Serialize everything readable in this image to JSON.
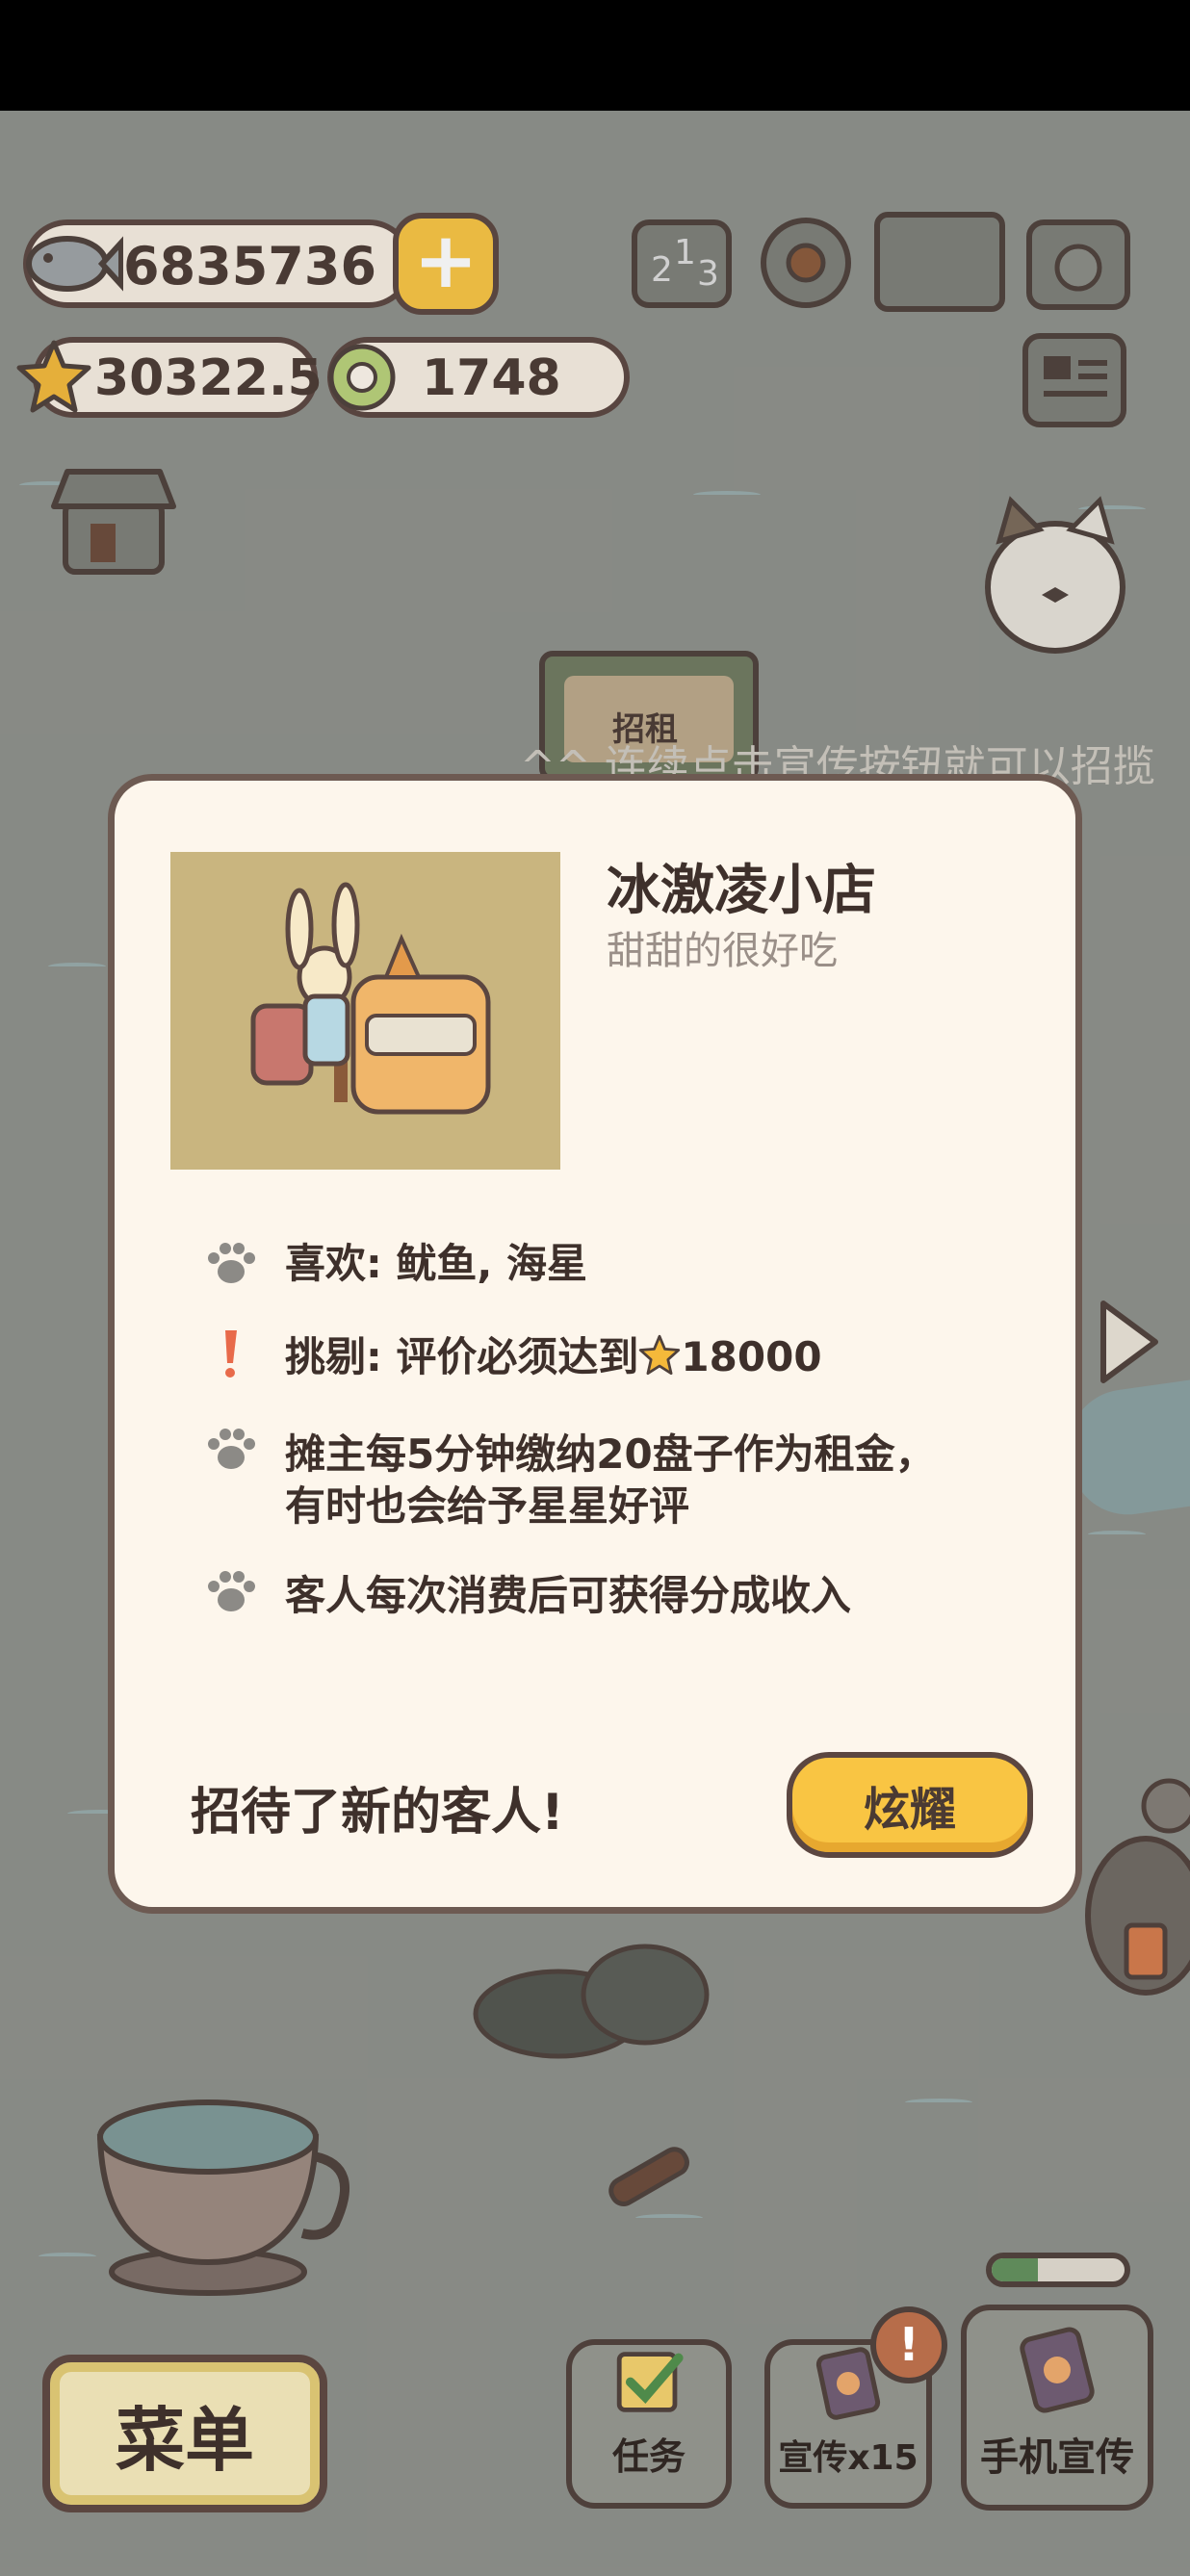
{
  "hud": {
    "fish_amount": "6835736",
    "star_amount": "30322.5",
    "ring_amount": "1748",
    "plus_label": "+"
  },
  "background": {
    "sign_label": "招租",
    "hint_text": "^^ 连续点击宣传按钮就可以招揽"
  },
  "popup": {
    "shop_name": "冰激凌小店",
    "shop_desc": "甜甜的很好吃",
    "rows": [
      {
        "icon": "paw-icon",
        "text": "喜欢: 鱿鱼, 海星"
      },
      {
        "icon": "exclamation-icon",
        "text_prefix": "挑剔: 评价必须达到",
        "star_icon": "star-icon",
        "text_suffix": "18000"
      },
      {
        "icon": "paw-icon",
        "line1": "摊主每5分钟缴纳20盘子作为租金，",
        "line2": "有时也会给予星星好评"
      },
      {
        "icon": "paw-icon",
        "text": "客人每次消费后可获得分成收入"
      }
    ],
    "footer_text": "招待了新的客人!",
    "share_label": "炫耀"
  },
  "bottom_bar": {
    "menu_label": "菜单",
    "task_label": "任务",
    "promo_label": "宣传x15",
    "phone_label": "手机宣传",
    "alert_badge": "!",
    "progress_fraction": 0.35
  },
  "colors": {
    "accent_yellow": "#f9c543",
    "border_brown": "#5b4640",
    "popup_bg": "#fdf6ec"
  }
}
